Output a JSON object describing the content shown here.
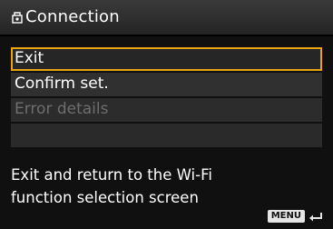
{
  "header": {
    "icon": "connection-icon",
    "title": "Connection"
  },
  "menu": {
    "items": [
      {
        "label": "Exit",
        "state": "selected"
      },
      {
        "label": "Confirm set.",
        "state": "normal"
      },
      {
        "label": "Error details",
        "state": "disabled"
      },
      {
        "label": "",
        "state": "empty"
      }
    ]
  },
  "description": "Exit and return to the Wi-Fi\nfunction selection screen",
  "footer": {
    "menu_label": "MENU",
    "back_icon": "return-arrow-icon"
  },
  "colors": {
    "selection_border": "#e9a313",
    "disabled_text": "#6e6e6e",
    "background": "#101010"
  }
}
